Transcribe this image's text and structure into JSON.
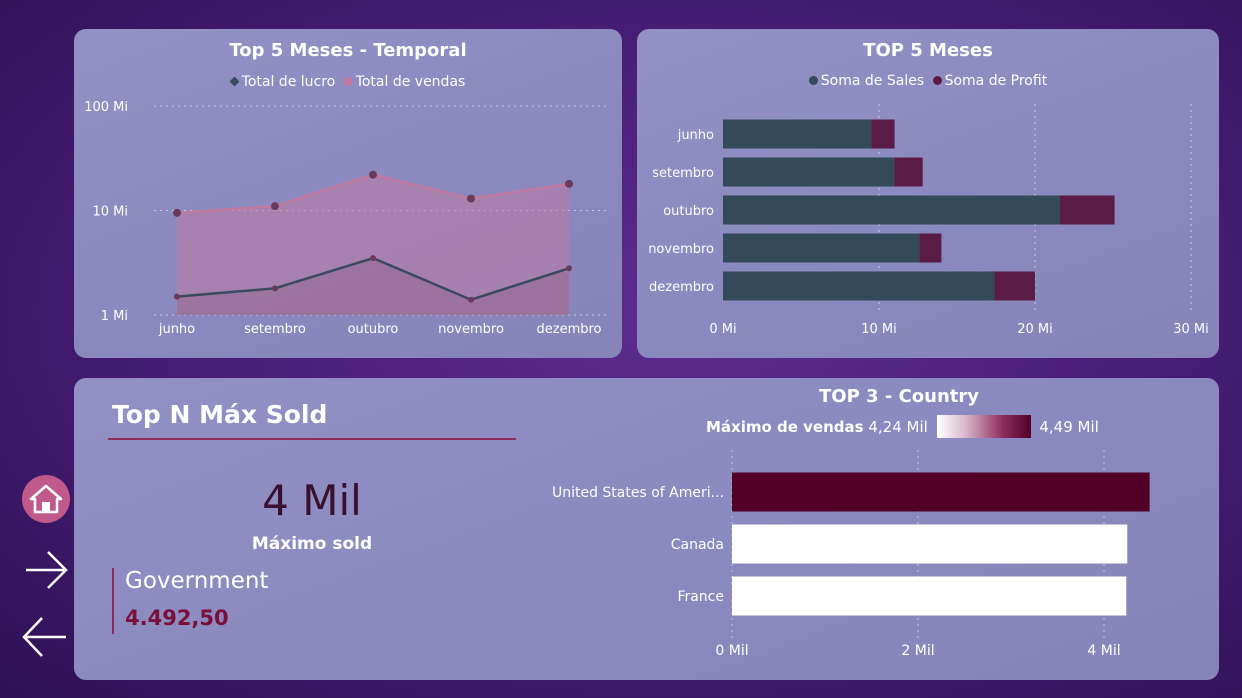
{
  "colors": {
    "lucro": "#3a4a5e",
    "vendas": "#c07aa2",
    "sales_bar": "#34495a",
    "profit_bar": "#5a1c46",
    "country_max": "#520028",
    "country_low": "#f6f1f6",
    "accent": "#8a2b5c",
    "home": "#c05a8a"
  },
  "icons": {
    "home": "home-icon",
    "next": "arrow-right-icon",
    "back": "arrow-left-icon"
  },
  "line_chart": {
    "title": "Top 5 Meses - Temporal",
    "legend": [
      "Total de lucro",
      "Total de vendas"
    ],
    "y_ticks": [
      "100 Mi",
      "10 Mi",
      "1 Mi"
    ]
  },
  "bar_chart": {
    "title": "TOP 5 Meses",
    "legend": [
      "Soma de  Sales",
      "Soma de Profit"
    ],
    "x_ticks": [
      "0 Mi",
      "10 Mi",
      "20 Mi",
      "30 Mi"
    ]
  },
  "card": {
    "title": "Top N Máx Sold",
    "value": "4 Mil",
    "label": "Máximo sold",
    "kpi_name": "Government",
    "kpi_value": "4.492,50"
  },
  "country_chart": {
    "title": "TOP 3 - Country",
    "legend_label": "Máximo de vendas",
    "legend_min": "4,24 Mil",
    "legend_max": "4,49 Mil",
    "x_ticks": [
      "0 Mil",
      "2 Mil",
      "4 Mil"
    ]
  },
  "chart_data": [
    {
      "type": "line",
      "title": "Top 5 Meses - Temporal",
      "categories": [
        "junho",
        "setembro",
        "outubro",
        "novembro",
        "dezembro"
      ],
      "y_scale": "log",
      "ylim": [
        1,
        100
      ],
      "series": [
        {
          "name": "Total de lucro",
          "values": [
            1.5,
            1.8,
            3.5,
            1.4,
            2.8
          ]
        },
        {
          "name": "Total de vendas",
          "values": [
            9.5,
            11,
            22,
            13,
            18
          ]
        }
      ]
    },
    {
      "type": "bar",
      "orientation": "horizontal",
      "stacked": true,
      "title": "TOP 5 Meses",
      "categories": [
        "junho",
        "setembro",
        "outubro",
        "novembro",
        "dezembro"
      ],
      "xlim": [
        0,
        30
      ],
      "series": [
        {
          "name": "Soma de  Sales",
          "values": [
            9.5,
            11.0,
            21.6,
            12.6,
            17.4
          ]
        },
        {
          "name": "Soma de Profit",
          "values": [
            1.5,
            1.8,
            3.5,
            1.4,
            2.6
          ]
        }
      ]
    },
    {
      "type": "bar",
      "orientation": "horizontal",
      "title": "TOP 3 - Country",
      "categories": [
        "United States of Ameri...",
        "Canada",
        "France"
      ],
      "values": [
        4.49,
        4.25,
        4.24
      ],
      "xlim": [
        0,
        4.6
      ]
    }
  ]
}
